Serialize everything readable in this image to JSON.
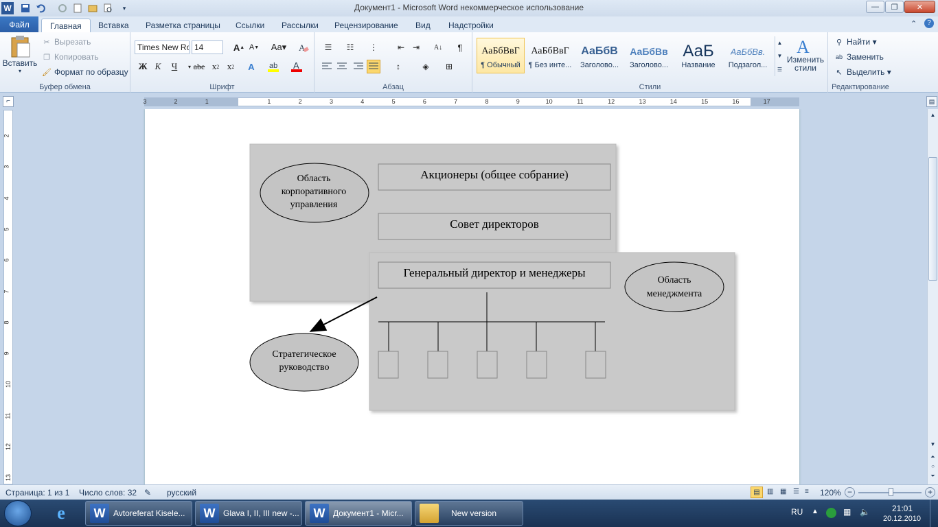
{
  "window": {
    "title": "Документ1 - Microsoft Word некоммерческое использование"
  },
  "tabs": [
    {
      "label": "Файл"
    },
    {
      "label": "Главная"
    },
    {
      "label": "Вставка"
    },
    {
      "label": "Разметка страницы"
    },
    {
      "label": "Ссылки"
    },
    {
      "label": "Рассылки"
    },
    {
      "label": "Рецензирование"
    },
    {
      "label": "Вид"
    },
    {
      "label": "Надстройки"
    }
  ],
  "clipboard": {
    "paste": "Вставить",
    "cut": "Вырезать",
    "copy": "Копировать",
    "format_painter": "Формат по образцу",
    "group": "Буфер обмена"
  },
  "font": {
    "name": "Times New Ro",
    "size": "14",
    "group": "Шрифт",
    "bold": "Ж",
    "italic": "К",
    "underline": "Ч",
    "strike": "abe"
  },
  "paragraph": {
    "group": "Абзац"
  },
  "styles": {
    "group": "Стили",
    "items": [
      {
        "sample": "АаБбВвГ",
        "name": "¶ Обычный"
      },
      {
        "sample": "АаБбВвГ",
        "name": "¶ Без инте..."
      },
      {
        "sample": "АаБбВ",
        "name": "Заголово..."
      },
      {
        "sample": "АаБбВв",
        "name": "Заголово..."
      },
      {
        "sample": "АаБ",
        "name": "Название"
      },
      {
        "sample": "АаБбВв.",
        "name": "Подзагол..."
      }
    ],
    "change": "Изменить стили"
  },
  "editing": {
    "group": "Редактирование",
    "find": "Найти",
    "replace": "Заменить",
    "select": "Выделить"
  },
  "ruler_numbers": [
    "3",
    "2",
    "1",
    "1",
    "2",
    "3",
    "4",
    "5",
    "6",
    "7",
    "8",
    "9",
    "10",
    "11",
    "12",
    "13",
    "14",
    "15",
    "16",
    "17"
  ],
  "vruler_numbers": [
    "2",
    "3",
    "4",
    "5",
    "6",
    "7",
    "8",
    "9",
    "10",
    "11",
    "12",
    "13"
  ],
  "diagram": {
    "corporate_area": "Область корпоративного управления",
    "shareholders": "Акционеры (общее собрание)",
    "board": "Совет директоров",
    "ceo": "Генеральный директор и менеджеры",
    "management_area": "Область менеджмента",
    "strategic": "Стратегическое руководство"
  },
  "status": {
    "page": "Страница: 1 из 1",
    "words": "Число слов: 32",
    "lang": "русский",
    "zoom": "120%"
  },
  "taskbar": {
    "items": [
      {
        "label": "Avtoreferat Kisele..."
      },
      {
        "label": "Glava I, II, III new -..."
      },
      {
        "label": "Документ1 - Micr..."
      },
      {
        "label": "New version"
      }
    ],
    "lang": "RU",
    "time": "21:01",
    "date": "20.12.2010"
  }
}
